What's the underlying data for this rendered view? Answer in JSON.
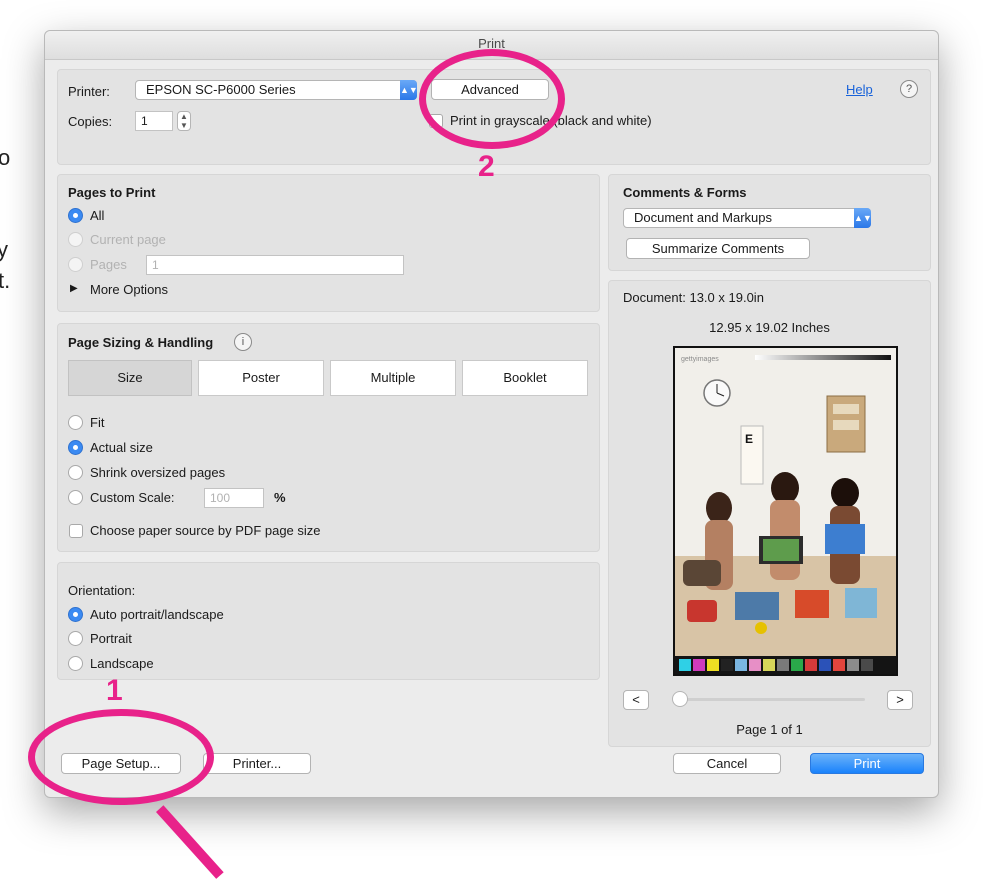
{
  "background_fragments": [
    "o",
    "y",
    "t."
  ],
  "dialog": {
    "title": "Print",
    "printer_label": "Printer:",
    "printer_value": "EPSON SC-P6000 Series",
    "advanced_button": "Advanced",
    "help_link": "Help",
    "help_icon": "?",
    "copies_label": "Copies:",
    "copies_value": "1",
    "grayscale_label": "Print in grayscale (black and white)"
  },
  "pages_to_print": {
    "title": "Pages to Print",
    "options": [
      "All",
      "Current page",
      "Pages"
    ],
    "pages_input_value": "1",
    "more_options": "More Options"
  },
  "sizing": {
    "title": "Page Sizing & Handling",
    "info_icon": "i",
    "tabs": [
      "Size",
      "Poster",
      "Multiple",
      "Booklet"
    ],
    "options": [
      "Fit",
      "Actual size",
      "Shrink oversized pages",
      "Custom Scale:"
    ],
    "custom_scale_value": "100",
    "percent": "%",
    "paper_source_label": "Choose paper source by PDF page size"
  },
  "orientation": {
    "title": "Orientation:",
    "options": [
      "Auto portrait/landscape",
      "Portrait",
      "Landscape"
    ]
  },
  "comments_forms": {
    "title": "Comments & Forms",
    "select_value": "Document and Markups",
    "summarize_button": "Summarize Comments"
  },
  "preview": {
    "document_size": "Document: 13.0 x 19.0in",
    "paper_size": "12.95 x 19.02 Inches",
    "image_watermark": "gettyimages",
    "prev_button": "<",
    "next_button": ">",
    "page_indicator": "Page 1 of 1"
  },
  "footer": {
    "page_setup": "Page Setup...",
    "printer": "Printer...",
    "cancel": "Cancel",
    "print": "Print"
  },
  "annotations": {
    "num1": "1",
    "num2": "2",
    "color": "#e8228a"
  },
  "colors": {
    "accent": "#3b8af2",
    "print_button": "#1a82fb",
    "link": "#1862d9"
  }
}
